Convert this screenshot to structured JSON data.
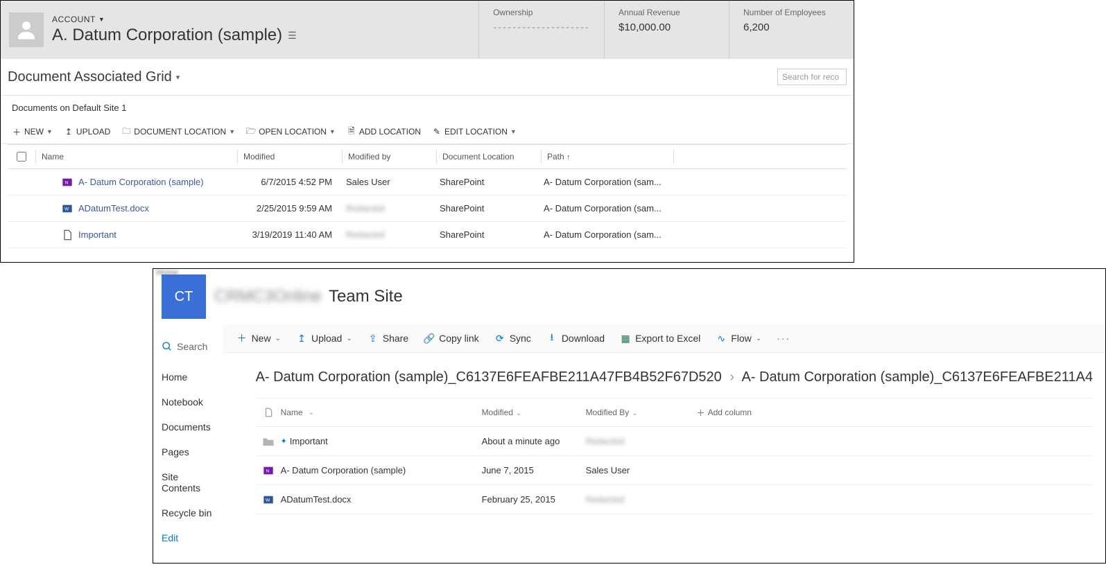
{
  "crm": {
    "entity_label": "ACCOUNT",
    "record_title": "A. Datum Corporation (sample)",
    "stats": {
      "ownership": {
        "label": "Ownership",
        "value": "--------------------"
      },
      "revenue": {
        "label": "Annual Revenue",
        "value": "$10,000.00"
      },
      "employees": {
        "label": "Number of Employees",
        "value": "6,200"
      }
    },
    "view_title": "Document Associated Grid",
    "search_placeholder": "Search for reco",
    "location_label": "Documents on Default Site 1",
    "toolbar": {
      "new": "NEW",
      "upload": "UPLOAD",
      "doc_location": "DOCUMENT LOCATION",
      "open_location": "OPEN LOCATION",
      "add_location": "ADD LOCATION",
      "edit_location": "EDIT LOCATION"
    },
    "columns": {
      "name": "Name",
      "modified": "Modified",
      "modified_by": "Modified by",
      "doc_location": "Document Location",
      "path": "Path"
    },
    "rows": [
      {
        "icon": "onenote",
        "name": "A- Datum Corporation (sample)",
        "modified": "6/7/2015 4:52 PM",
        "modified_by": "Sales User",
        "modified_by_blur": false,
        "location": "SharePoint",
        "path": "A- Datum Corporation (sam..."
      },
      {
        "icon": "word",
        "name": "ADatumTest.docx",
        "modified": "2/25/2015 9:59 AM",
        "modified_by": "Redacted",
        "modified_by_blur": true,
        "location": "SharePoint",
        "path": "A- Datum Corporation (sam..."
      },
      {
        "icon": "generic",
        "name": "Important",
        "modified": "3/19/2019 11:40 AM",
        "modified_by": "Redacted",
        "modified_by_blur": true,
        "location": "SharePoint",
        "path": "A- Datum Corporation (sam..."
      }
    ]
  },
  "sp": {
    "logo_text": "CT",
    "site_prefix": "CRMC3Online",
    "site_title": "Team Site",
    "search_label": "Search",
    "nav": [
      "Home",
      "Notebook",
      "Documents",
      "Pages",
      "Site Contents",
      "Recycle bin"
    ],
    "nav_edit": "Edit",
    "cmd": {
      "new": "New",
      "upload": "Upload",
      "share": "Share",
      "copylink": "Copy link",
      "sync": "Sync",
      "download": "Download",
      "excel": "Export to Excel",
      "flow": "Flow"
    },
    "breadcrumb": {
      "part1": "A- Datum Corporation (sample)_C6137E6FEAFBE211A47FB4B52F67D520",
      "part2": "A- Datum Corporation (sample)_C6137E6FEAFBE211A4"
    },
    "columns": {
      "name": "Name",
      "modified": "Modified",
      "modified_by": "Modified By",
      "add": "Add column"
    },
    "rows": [
      {
        "icon": "folder",
        "name": "Important",
        "name_prefix_icon": true,
        "modified": "About a minute ago",
        "modified_by": "Redacted",
        "modified_by_blur": true
      },
      {
        "icon": "onenote",
        "name": "A- Datum Corporation (sample)",
        "modified": "June 7, 2015",
        "modified_by": "Sales User",
        "modified_by_blur": false
      },
      {
        "icon": "word",
        "name": "ADatumTest.docx",
        "modified": "February 25, 2015",
        "modified_by": "Redacted",
        "modified_by_blur": true
      }
    ]
  }
}
